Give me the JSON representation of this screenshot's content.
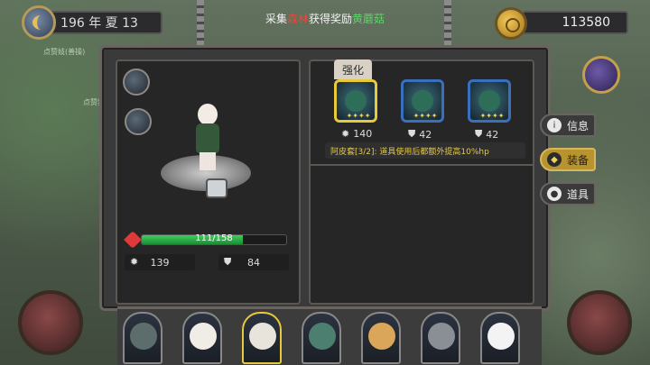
{
  "header": {
    "date_text": "196 年 夏 13",
    "quest_prefix": "采集",
    "quest_highlight": "森林",
    "quest_middle": "获得奖励",
    "quest_reward": "黄蘑菇",
    "gold": "113580"
  },
  "hero": {
    "hp_text": "111/158",
    "hp_fraction": 0.7,
    "attack": "139",
    "defense": "84"
  },
  "equipment": {
    "tab_label": "强化",
    "items": [
      {
        "value": "140",
        "stat_icon": "attack-icon",
        "selected": true
      },
      {
        "value": "42",
        "stat_icon": "shield-icon",
        "selected": false
      },
      {
        "value": "42",
        "stat_icon": "shield-icon",
        "selected": false
      }
    ],
    "set_bonus": "阿皮套[3/2]: 道具使用后都额外提高10%hp"
  },
  "side_tabs": [
    {
      "label": "信息",
      "icon": "info-icon"
    },
    {
      "label": "装备",
      "icon": "equipment-icon"
    },
    {
      "label": "道具",
      "icon": "item-icon"
    }
  ],
  "map_labels": [
    "点赞妓(善操)",
    "点赞我"
  ],
  "colors": {
    "hp": "#3ecf5c",
    "selected_border": "#e8c93a",
    "set_text": "#e4c84c",
    "quest_highlight": "#e04c3c",
    "quest_reward": "#5fd16a"
  }
}
